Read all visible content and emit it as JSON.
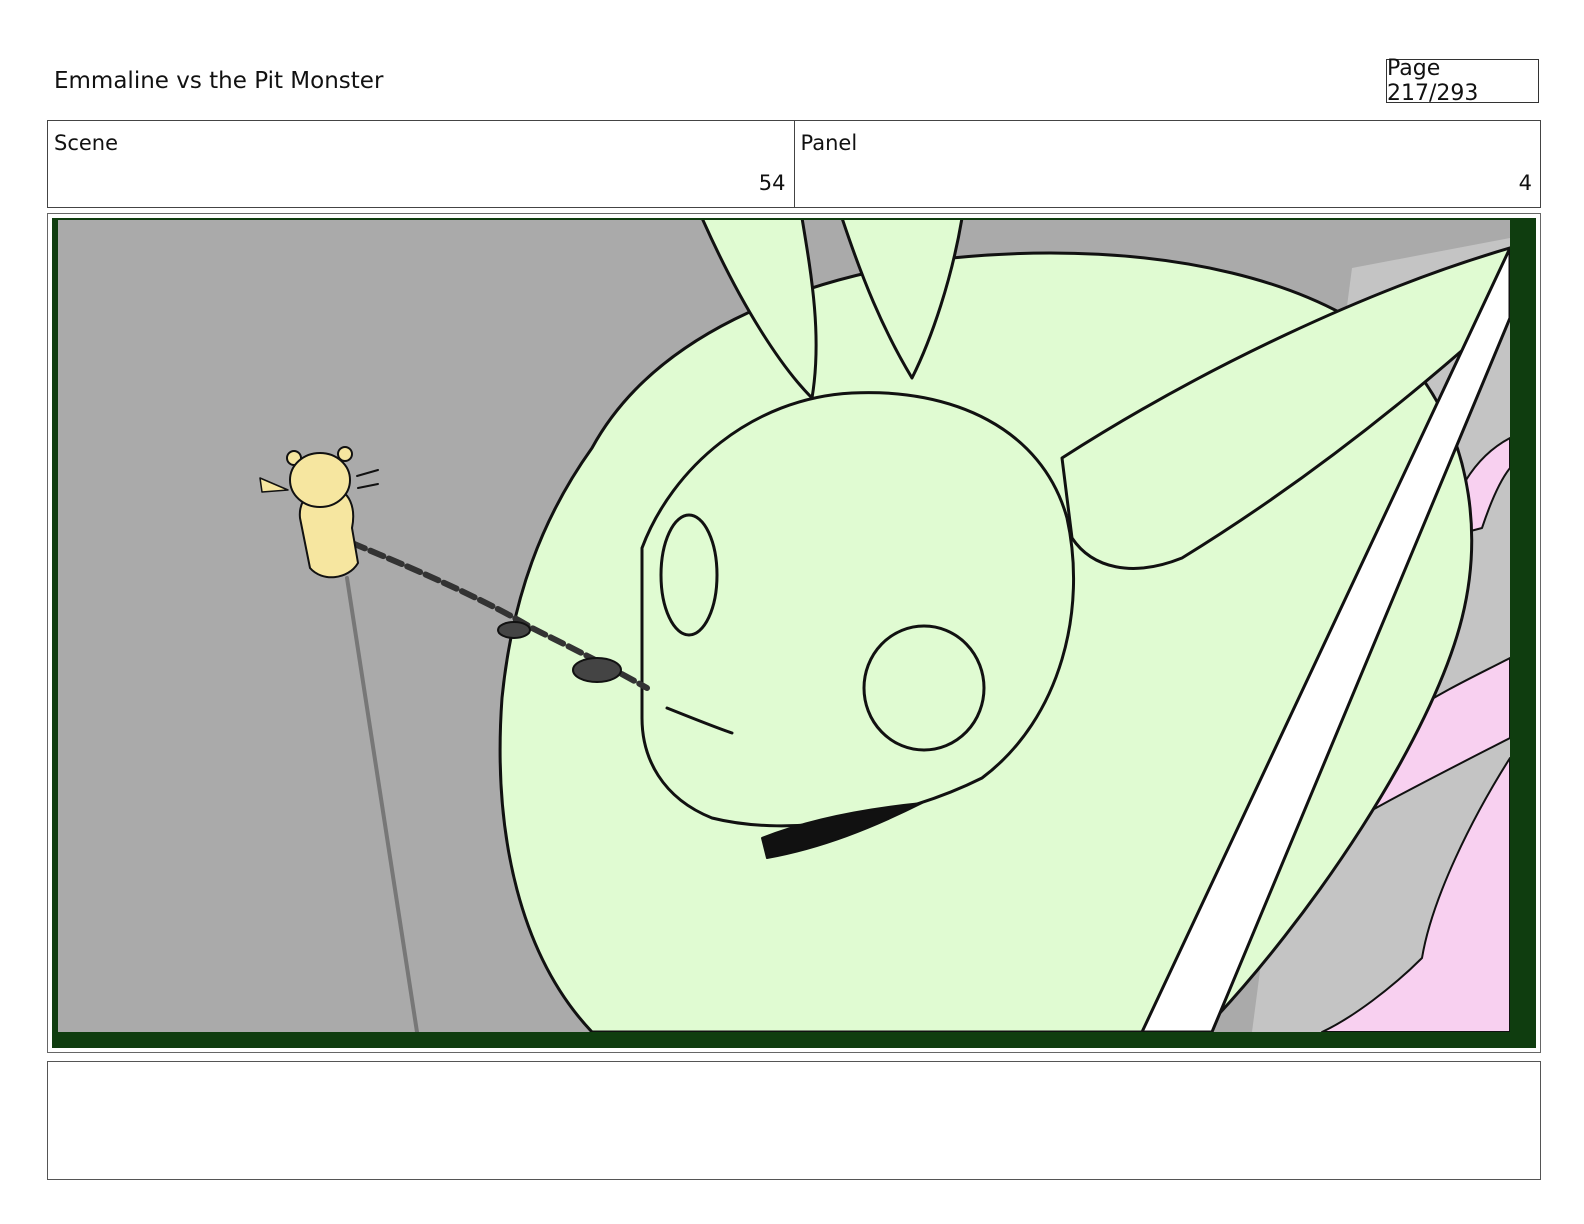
{
  "document": {
    "title": "Emmaline vs the Pit Monster",
    "page_label": "Page 217/293"
  },
  "info": {
    "scene_label": "Scene",
    "scene_value": "54",
    "panel_label": "Panel",
    "panel_value": "4"
  },
  "notes": {
    "text": ""
  },
  "colors": {
    "background": "#aaaaaa",
    "monster_fill": "#e0fbd2",
    "character_fill": "#f6e6a0",
    "tentacle_fill": "#f8d0f0",
    "light_gray": "#c4c4c4",
    "frame_border": "#0f3d0f"
  }
}
